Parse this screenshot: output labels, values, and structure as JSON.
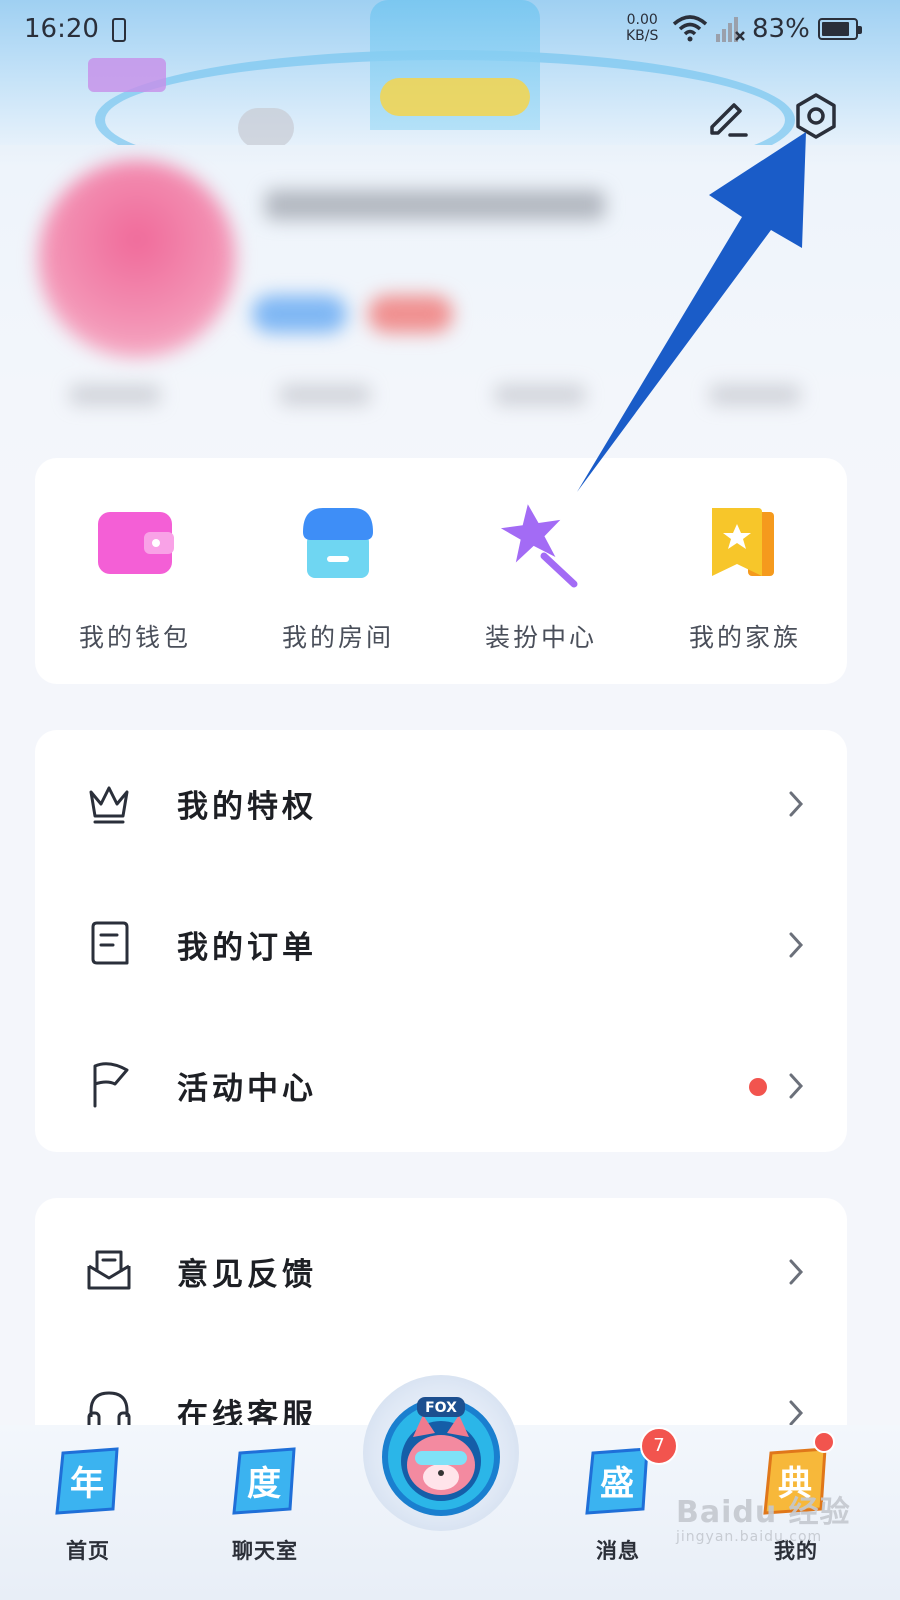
{
  "status_bar": {
    "time": "16:20",
    "net_speed_value": "0.00",
    "net_speed_unit": "KB/S",
    "battery_percent": "83%",
    "battery_level": 0.83
  },
  "header": {
    "edit_icon": "pencil-icon",
    "settings_icon": "gear-icon"
  },
  "quick_tools": [
    {
      "label": "我的钱包",
      "icon": "wallet-icon",
      "color": "#f45fd6"
    },
    {
      "label": "我的房间",
      "icon": "store-icon",
      "color": "#3e8ef7"
    },
    {
      "label": "装扮中心",
      "icon": "magic-wand-icon",
      "color": "#a36bf5"
    },
    {
      "label": "我的家族",
      "icon": "family-book-icon",
      "color": "#f7b51d"
    }
  ],
  "menu_group_1": [
    {
      "label": "我的特权",
      "icon": "crown-icon",
      "has_dot": false
    },
    {
      "label": "我的订单",
      "icon": "order-icon",
      "has_dot": false
    },
    {
      "label": "活动中心",
      "icon": "flag-icon",
      "has_dot": true
    }
  ],
  "menu_group_2": [
    {
      "label": "意见反馈",
      "icon": "feedback-mail-icon",
      "has_dot": false
    },
    {
      "label": "在线客服",
      "icon": "headset-icon",
      "has_dot": false
    }
  ],
  "tab_bar": {
    "tabs": [
      {
        "label": "首页",
        "icon_char": "年"
      },
      {
        "label": "聊天室",
        "icon_char": "度"
      },
      {
        "label": "消息",
        "icon_char": "盛"
      },
      {
        "label": "我的",
        "icon_char": "典"
      }
    ],
    "center_badge_text": "FOX",
    "message_badge": "7"
  },
  "watermark": {
    "line1": "Baidu 经验",
    "line2": "jingyan.baidu.com"
  },
  "colors": {
    "accent_red": "#f2544e",
    "annotation_arrow": "#1a5cc8"
  }
}
